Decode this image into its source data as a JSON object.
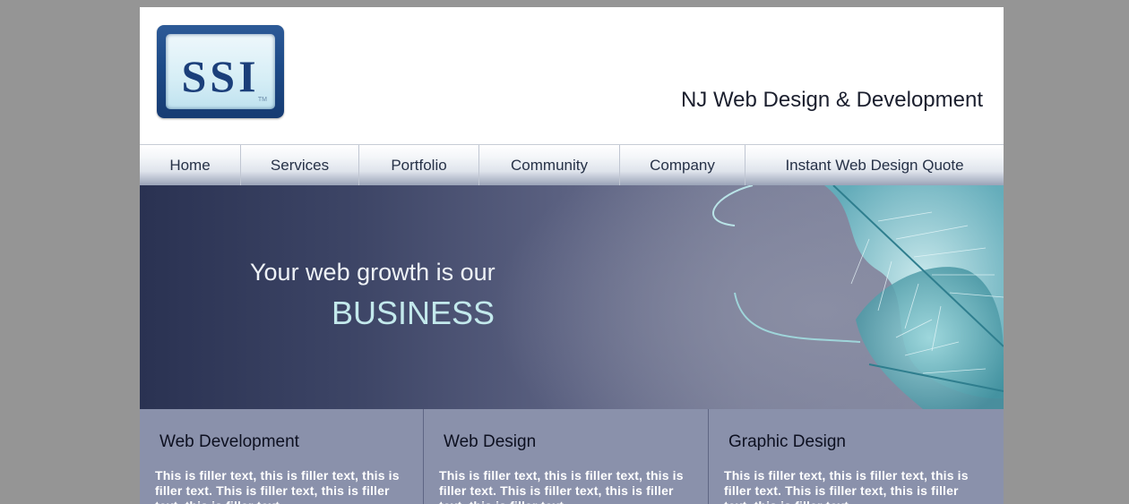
{
  "header": {
    "logo_text": "SSI",
    "logo_tm": "TM",
    "tagline": "NJ Web Design & Development"
  },
  "nav": {
    "items": [
      {
        "label": "Home"
      },
      {
        "label": "Services"
      },
      {
        "label": "Portfolio"
      },
      {
        "label": "Community"
      },
      {
        "label": "Company"
      },
      {
        "label": "Instant Web Design Quote"
      }
    ]
  },
  "banner": {
    "line1": "Your web growth is our",
    "line2": "BUSINESS"
  },
  "columns": [
    {
      "title": "Web Development",
      "body": "This is filler text, this is filler text, this is filler text. This is filler text, this is filler text, this is filler text."
    },
    {
      "title": "Web Design",
      "body": "This is filler text, this is filler text, this is filler text. This is filler text, this is filler text, this is filler text."
    },
    {
      "title": "Graphic Design",
      "body": "This is filler text, this is filler text, this is filler text. This is filler text, this is filler text, this is filler text."
    }
  ],
  "colors": {
    "page_bg": "#959595",
    "logo_blue": "#1b3f7a",
    "banner_text_accent": "#c3e9ec",
    "column_bg": "#8a91ab"
  }
}
